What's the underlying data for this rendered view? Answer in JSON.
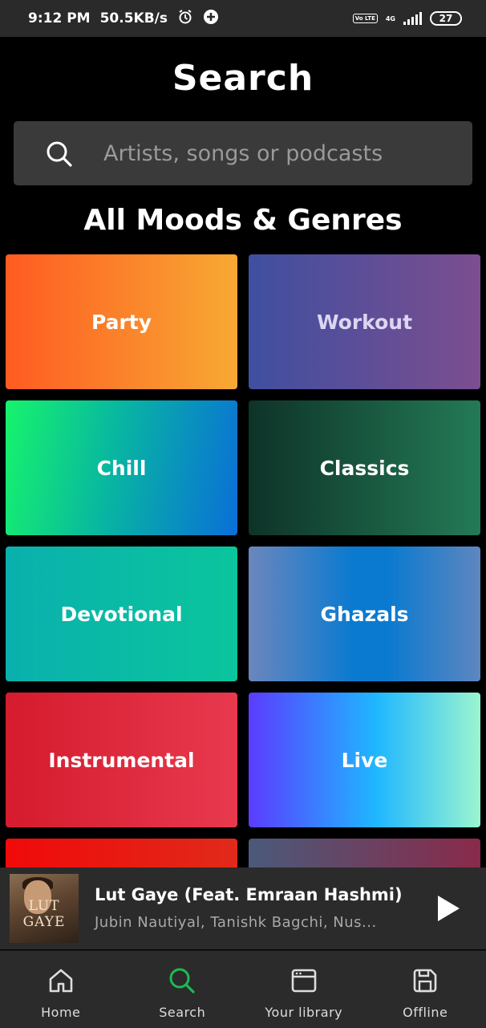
{
  "status_bar": {
    "time": "9:12 PM",
    "speed": "50.5KB/s",
    "volte": "Vo LTE",
    "network": "4G",
    "battery": "27"
  },
  "header": {
    "title": "Search"
  },
  "search": {
    "placeholder": "Artists, songs or podcasts"
  },
  "section": {
    "title": "All Moods & Genres"
  },
  "genres": [
    {
      "label": "Party"
    },
    {
      "label": "Workout"
    },
    {
      "label": "Chill"
    },
    {
      "label": "Classics"
    },
    {
      "label": "Devotional"
    },
    {
      "label": "Ghazals"
    },
    {
      "label": "Instrumental"
    },
    {
      "label": "Live"
    }
  ],
  "colors": {
    "party": [
      "#ff5b22",
      "#f7a933"
    ],
    "workout": [
      "#3f4fa0",
      "#7c4e8f"
    ],
    "chill": [
      "#17f36c",
      "#0a6fd8"
    ],
    "classics": [
      "#0e3328",
      "#237a56"
    ],
    "devotional": [
      "#0ab0ad",
      "#0ac59d"
    ],
    "ghazals": [
      "#6b86bd",
      "#0a7ad0"
    ],
    "instrumental": [
      "#d51b2d",
      "#e8394e"
    ],
    "live": [
      "#5a3cff",
      "#9bf5cf"
    ],
    "accent_green": "#1db954"
  },
  "now_playing": {
    "album_art_text": "LUT GAYE",
    "title": "Lut Gaye (Feat. Emraan Hashmi)",
    "artists": "Jubin Nautiyal, Tanishk Bagchi, Nus..."
  },
  "nav": {
    "items": [
      {
        "label": "Home",
        "icon": "home-icon"
      },
      {
        "label": "Search",
        "icon": "search-icon",
        "active": true
      },
      {
        "label": "Your library",
        "icon": "library-icon"
      },
      {
        "label": "Offline",
        "icon": "save-icon"
      }
    ]
  }
}
